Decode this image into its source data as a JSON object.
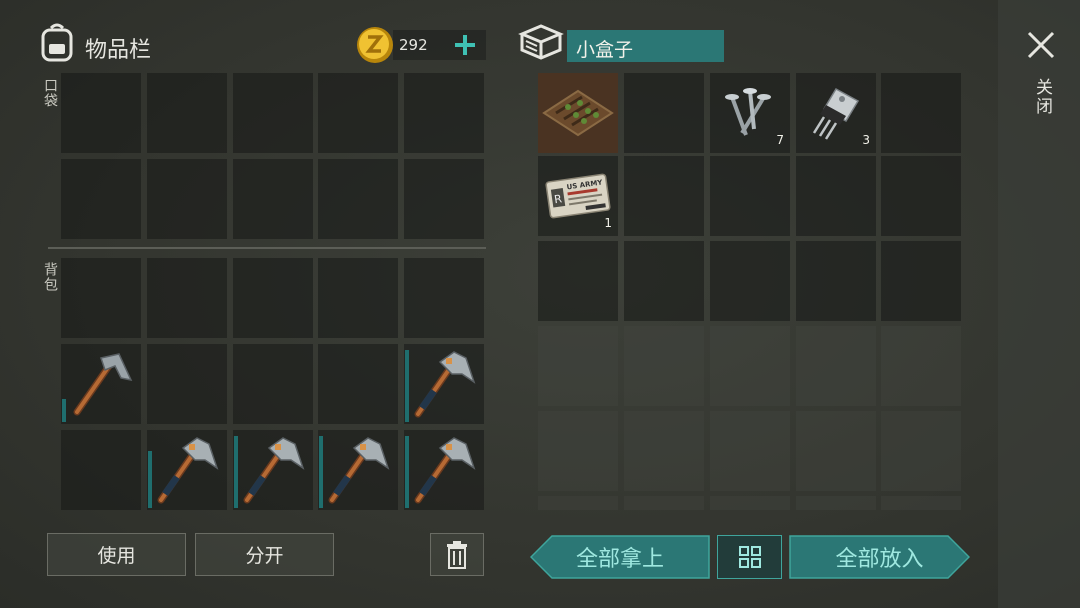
{
  "inventory": {
    "title": "物品栏",
    "coins": "292",
    "add_label": "+",
    "pocket_label": "口袋",
    "backpack_label": "背包",
    "slots": [
      {
        "item": "pickaxe",
        "durability": 0.3
      },
      {
        "item": "empty"
      },
      {
        "item": "empty"
      },
      {
        "item": "empty"
      },
      {
        "item": "hammer",
        "durability": 0.95
      },
      {
        "item": "empty"
      },
      {
        "item": "hammer",
        "durability": 0.75
      },
      {
        "item": "hammer",
        "durability": 0.95
      },
      {
        "item": "hammer",
        "durability": 0.95
      },
      {
        "item": "hammer",
        "durability": 0.95
      }
    ]
  },
  "container": {
    "title": "小盒子",
    "items": [
      {
        "item": "farm-plot-icon",
        "count": ""
      },
      {
        "item": "nails-icon",
        "count": "7"
      },
      {
        "item": "transistor-icon",
        "count": "3"
      },
      {
        "item": "army-id-card-icon",
        "count": "1",
        "card_lines": [
          "US ARMY",
          "R"
        ]
      }
    ]
  },
  "buttons": {
    "use": "使用",
    "split": "分开",
    "take_all": "全部拿上",
    "put_all": "全部放入",
    "close": "关闭"
  },
  "colors": {
    "teal": "#2e8c86",
    "teal_text": "#9fe8e0",
    "durability": "#1f6e6e"
  }
}
